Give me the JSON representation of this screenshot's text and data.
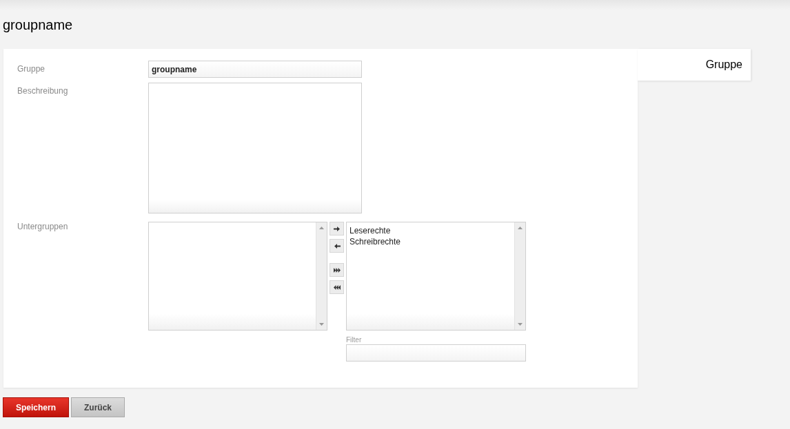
{
  "page_title": "groupname",
  "tabs": [
    {
      "label": "Gruppe",
      "selected": true
    }
  ],
  "form": {
    "group": {
      "label": "Gruppe",
      "value": "groupname"
    },
    "description": {
      "label": "Beschreibung"
    },
    "subgroups": {
      "label": "Untergruppen",
      "assigned": [
        {
          "label": "Leserechte"
        },
        {
          "label": "Schreibrechte"
        }
      ],
      "filter": {
        "label": "Filter"
      }
    }
  },
  "buttons": [
    {
      "label": "Speichern",
      "kind": "primary"
    },
    {
      "label": "Zurück",
      "kind": "secondary"
    }
  ]
}
